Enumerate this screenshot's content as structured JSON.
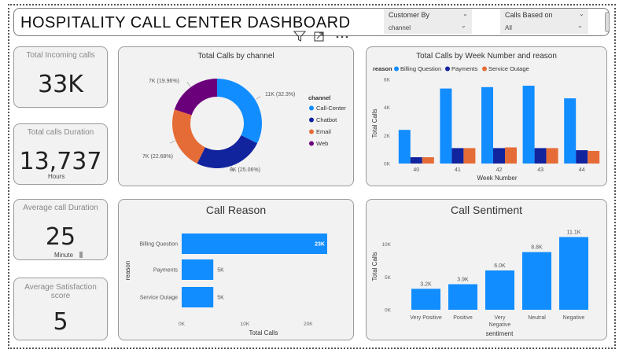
{
  "header": {
    "title": "HOSPITALITY CALL CENTER DASHBOARD",
    "slicer1": {
      "label": "Customer By",
      "value": "channel"
    },
    "slicer2": {
      "label": "Calls Based on",
      "value": "All"
    }
  },
  "kpis": {
    "incoming": {
      "label": "Total Incoming calls",
      "value": "33K"
    },
    "duration": {
      "label": "Total calls Duration",
      "value": "13,737",
      "unit": "Hours"
    },
    "avg_duration": {
      "label": "Average call Duration",
      "value": "25",
      "unit": "Minute"
    },
    "satisfaction": {
      "label": "Average Satisfaction score",
      "value": "5"
    }
  },
  "donut": {
    "title": "Total Calls by channel",
    "legend_title": "channel",
    "chart_data": {
      "type": "pie",
      "slices": [
        {
          "name": "Call-Center",
          "label": "11K (32.3%)",
          "value": 32.3,
          "color": "#118dff"
        },
        {
          "name": "Chatbot",
          "label": "8K (25.06%)",
          "value": 25.06,
          "color": "#12239e"
        },
        {
          "name": "Email",
          "label": "7K (22.68%)",
          "value": 22.68,
          "color": "#e66c37"
        },
        {
          "name": "Web",
          "label": "7K (19.96%)",
          "value": 19.96,
          "color": "#6b007b"
        }
      ]
    }
  },
  "week_chart": {
    "title": "Total Calls by Week Number and reason",
    "legend_title": "reason",
    "xlabel": "Week Number",
    "ylabel": "Total Calls",
    "chart_data": {
      "type": "bar",
      "categories": [
        "40",
        "41",
        "42",
        "43",
        "44"
      ],
      "series": [
        {
          "name": "Billing Question",
          "color": "#118dff",
          "values": [
            2400,
            5350,
            5450,
            5550,
            4650
          ]
        },
        {
          "name": "Payments",
          "color": "#12239e",
          "values": [
            450,
            1100,
            1100,
            1100,
            950
          ]
        },
        {
          "name": "Service Outage",
          "color": "#e66c37",
          "values": [
            450,
            1100,
            1150,
            1100,
            900
          ]
        }
      ],
      "ylim": [
        0,
        6000
      ],
      "yticks": [
        "0K",
        "2K",
        "4K",
        "6K"
      ]
    }
  },
  "reason_chart": {
    "title": "Call Reason",
    "xlabel": "Total Calls",
    "ylabel": "reason",
    "chart_data": {
      "type": "bar",
      "orientation": "horizontal",
      "categories": [
        "Billing Question",
        "Payments",
        "Service Outage"
      ],
      "values": [
        23000,
        5000,
        5000
      ],
      "data_labels": [
        "23K",
        "5K",
        "5K"
      ],
      "xlim": [
        0,
        24000
      ],
      "xticks": [
        "0K",
        "10K",
        "20K"
      ],
      "color": "#118dff"
    }
  },
  "sentiment_chart": {
    "title": "Call Sentiment",
    "xlabel": "sentiment",
    "ylabel": "Total Calls",
    "chart_data": {
      "type": "bar",
      "categories": [
        "Very Positive",
        "Positive",
        "Very Negative",
        "Neutral",
        "Negative"
      ],
      "values": [
        3200,
        3900,
        6000,
        8800,
        11100
      ],
      "data_labels": [
        "3.2K",
        "3.9K",
        "6.0K",
        "8.8K",
        "11.1K"
      ],
      "ylim": [
        0,
        12000
      ],
      "yticks": [
        "0K",
        "5K",
        "10K"
      ],
      "color": "#118dff"
    }
  }
}
